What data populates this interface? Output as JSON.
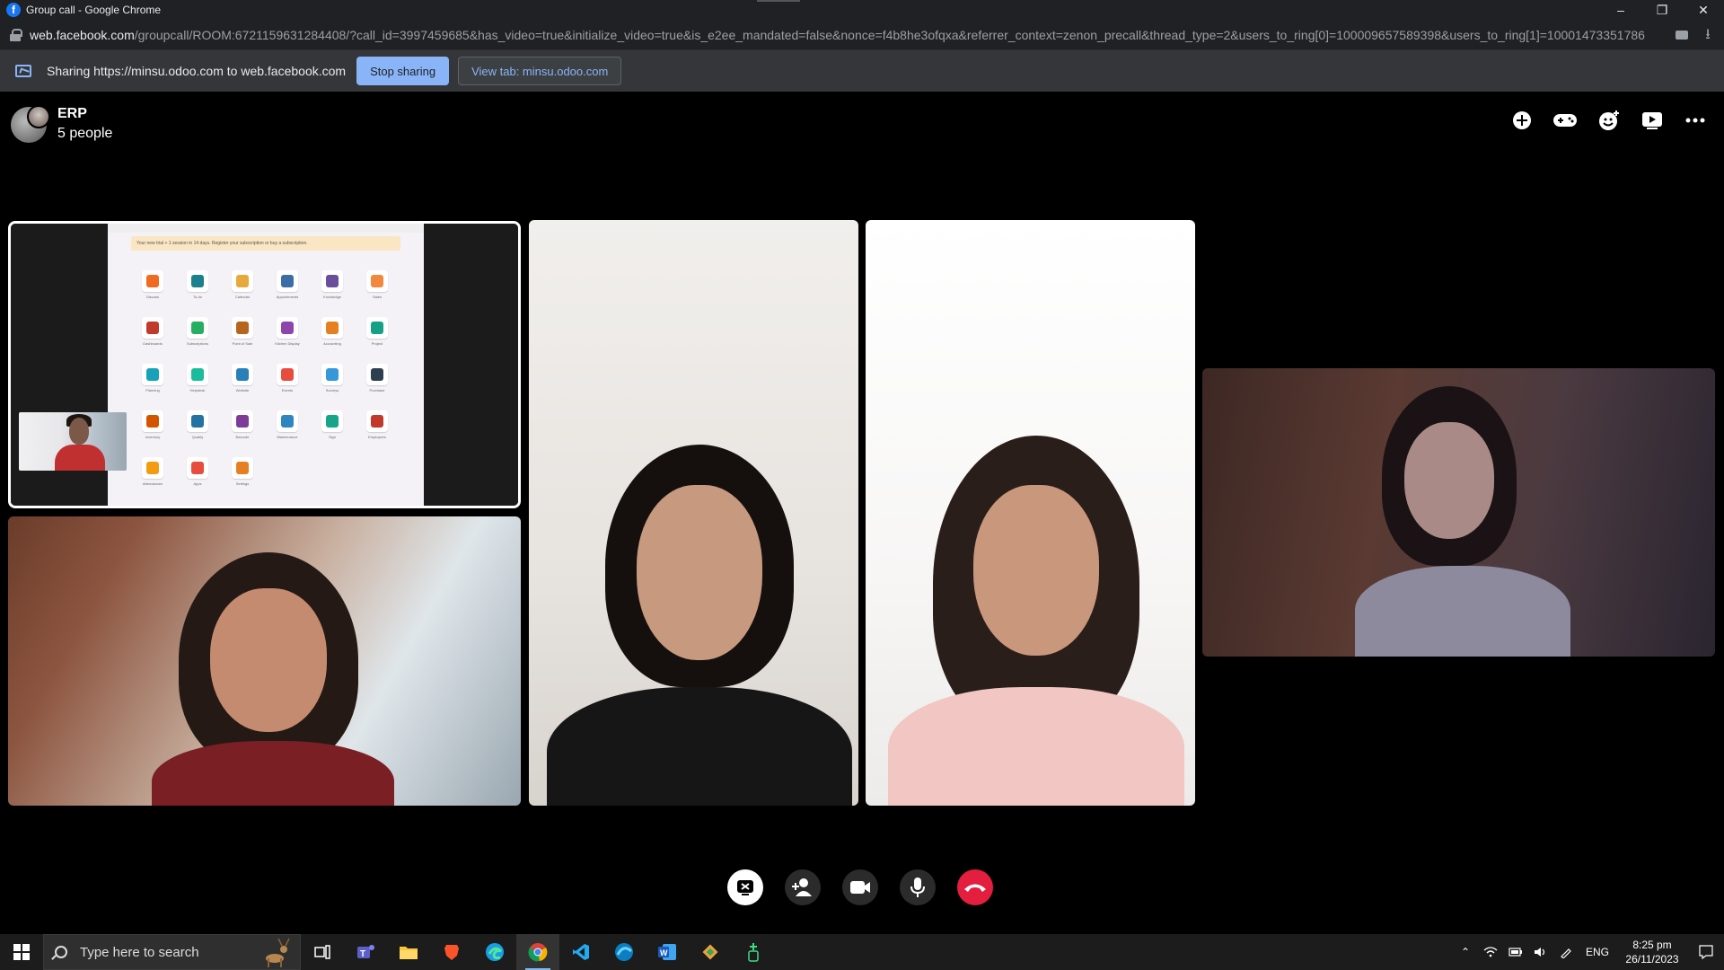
{
  "browser": {
    "window_title": "Group call - Google Chrome",
    "url_host": "web.facebook.com",
    "url_rest": "/groupcall/ROOM:6721159631284408/?call_id=3997459685&has_video=true&initialize_video=true&is_e2ee_mandated=false&nonce=f4b8he3ofqxa&referrer_context=zenon_precall&thread_type=2&users_to_ring[0]=100009657589398&users_to_ring[1]=10001473351786..."
  },
  "share_bar": {
    "message": "Sharing https://minsu.odoo.com to web.facebook.com",
    "stop_label": "Stop sharing",
    "view_label": "View tab: minsu.odoo.com"
  },
  "call": {
    "group_name": "ERP",
    "people_count": "5 people"
  },
  "shared_screen": {
    "banner": "Your new trial + 1 session in 14 days. Register your subscription or buy a subscription.",
    "apps": [
      {
        "label": "Discuss",
        "color": "#f06b1f"
      },
      {
        "label": "To-do",
        "color": "#1b7f8e"
      },
      {
        "label": "Calendar",
        "color": "#e7a93b"
      },
      {
        "label": "Appointments",
        "color": "#3a6ea5"
      },
      {
        "label": "Knowledge",
        "color": "#6a4e9c"
      },
      {
        "label": "Sales",
        "color": "#f0883e"
      },
      {
        "label": "Dashboards",
        "color": "#c0392b"
      },
      {
        "label": "Subscriptions",
        "color": "#27ae60"
      },
      {
        "label": "Point of Sale",
        "color": "#b5651d"
      },
      {
        "label": "Kitchen Display",
        "color": "#8e44ad"
      },
      {
        "label": "Accounting",
        "color": "#e67e22"
      },
      {
        "label": "Project",
        "color": "#16a085"
      },
      {
        "label": "Planning",
        "color": "#17a2b8"
      },
      {
        "label": "Helpdesk",
        "color": "#1abc9c"
      },
      {
        "label": "Website",
        "color": "#2980b9"
      },
      {
        "label": "Events",
        "color": "#e74c3c"
      },
      {
        "label": "Surveys",
        "color": "#3498db"
      },
      {
        "label": "Purchase",
        "color": "#2c3e50"
      },
      {
        "label": "Inventory",
        "color": "#d35400"
      },
      {
        "label": "Quality",
        "color": "#2471a3"
      },
      {
        "label": "Barcode",
        "color": "#7d3c98"
      },
      {
        "label": "Maintenance",
        "color": "#2e86c1"
      },
      {
        "label": "Sign",
        "color": "#17a589"
      },
      {
        "label": "Employees",
        "color": "#c0392b"
      },
      {
        "label": "Attendances",
        "color": "#f39c12"
      },
      {
        "label": "Apps",
        "color": "#e74c3c"
      },
      {
        "label": "Settings",
        "color": "#e67e22"
      }
    ]
  },
  "controls": {
    "items": [
      "share-screen",
      "add-person",
      "camera",
      "microphone",
      "end-call"
    ]
  },
  "taskbar": {
    "search_placeholder": "Type here to search",
    "language": "ENG",
    "time": "8:25 pm",
    "date": "26/11/2023"
  },
  "colors": {
    "accent": "#8ab4f8",
    "end_call": "#e41e3f",
    "facebook": "#1877f2"
  }
}
